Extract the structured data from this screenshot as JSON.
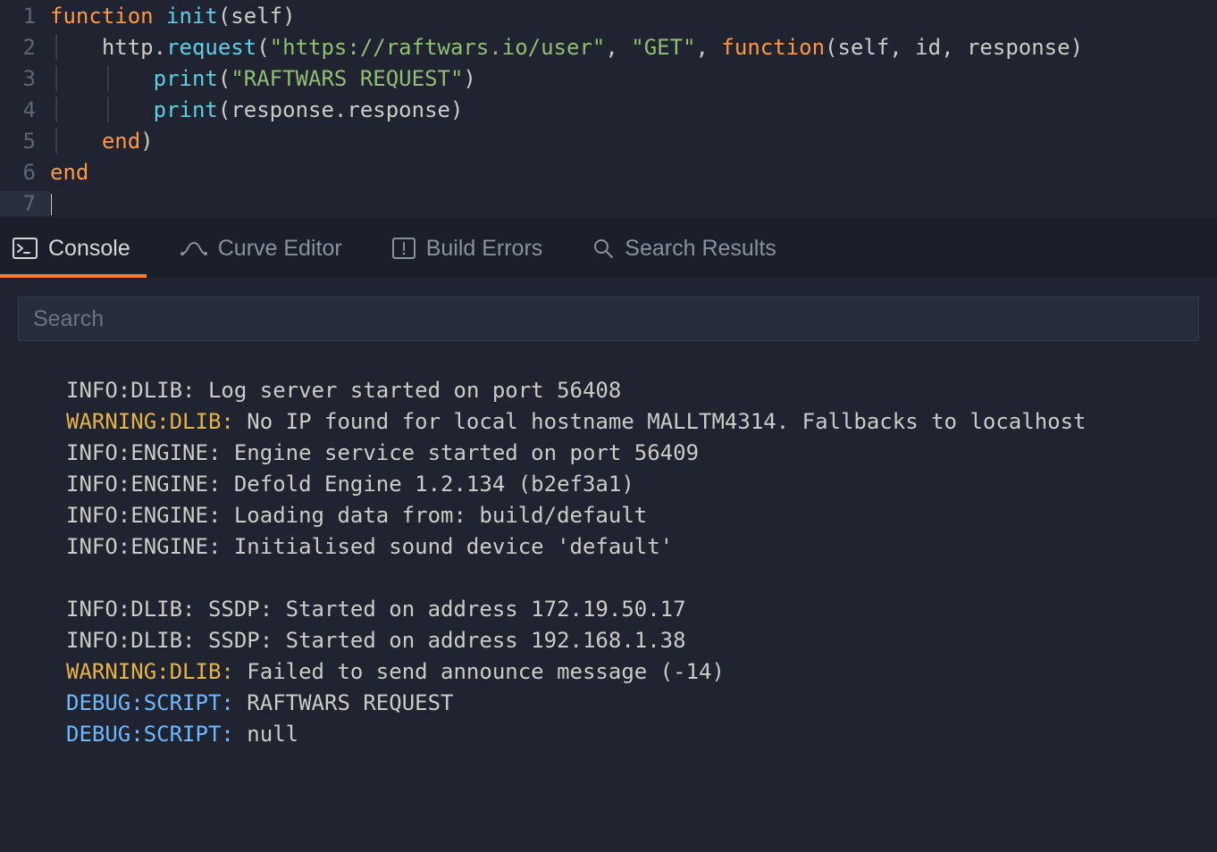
{
  "editor": {
    "lines": [
      {
        "num": "1",
        "html": "<span class='kw'>function</span> <span class='fn'>init</span><span class='pn'>(</span><span class='id'>self</span><span class='pn'>)</span>"
      },
      {
        "num": "2",
        "html": "<span class='guide'>·   </span><span class='id'>http</span><span class='pn'>.</span><span class='fn'>request</span><span class='pn'>(</span><span class='str'>\"https://raftwars.io/user\"</span><span class='pn'>, </span><span class='str'>\"GET\"</span><span class='pn'>, </span><span class='kw'>function</span><span class='pn'>(</span><span class='id'>self</span><span class='pn'>, </span><span class='id'>id</span><span class='pn'>, </span><span class='id'>response</span><span class='pn'>)</span>"
      },
      {
        "num": "3",
        "html": "<span class='guide'>·   ·   </span><span class='fn'>print</span><span class='pn'>(</span><span class='str'>\"RAFTWARS REQUEST\"</span><span class='pn'>)</span>"
      },
      {
        "num": "4",
        "html": "<span class='guide'>·   ·   </span><span class='fn'>print</span><span class='pn'>(</span><span class='id'>response</span><span class='pn'>.</span><span class='id'>response</span><span class='pn'>)</span>"
      },
      {
        "num": "5",
        "html": "<span class='guide'>·   </span><span class='kw'>end</span><span class='pn'>)</span>"
      },
      {
        "num": "6",
        "html": "<span class='kw'>end</span>"
      },
      {
        "num": "7",
        "html": "<span class='cursor'></span>",
        "active": true
      }
    ]
  },
  "tabs": {
    "console": "Console",
    "curve": "Curve Editor",
    "build": "Build Errors",
    "search": "Search Results"
  },
  "console": {
    "search_placeholder": "Search",
    "lines": [
      {
        "prefix": "INFO:DLIB: ",
        "cls": "info",
        "msg": "Log server started on port 56408"
      },
      {
        "prefix": "WARNING:DLIB: ",
        "cls": "warn",
        "msg": "No IP found for local hostname MALLTM4314. Fallbacks to localhost"
      },
      {
        "prefix": "INFO:ENGINE: ",
        "cls": "info",
        "msg": "Engine service started on port 56409"
      },
      {
        "prefix": "INFO:ENGINE: ",
        "cls": "info",
        "msg": "Defold Engine 1.2.134 (b2ef3a1)"
      },
      {
        "prefix": "INFO:ENGINE: ",
        "cls": "info",
        "msg": "Loading data from: build/default"
      },
      {
        "prefix": "INFO:ENGINE: ",
        "cls": "info",
        "msg": "Initialised sound device 'default'"
      },
      {
        "blank": true
      },
      {
        "prefix": "INFO:DLIB: ",
        "cls": "info",
        "msg": "SSDP: Started on address 172.19.50.17"
      },
      {
        "prefix": "INFO:DLIB: ",
        "cls": "info",
        "msg": "SSDP: Started on address 192.168.1.38"
      },
      {
        "prefix": "WARNING:DLIB: ",
        "cls": "warn",
        "msg": "Failed to send announce message (-14)"
      },
      {
        "prefix": "DEBUG:SCRIPT: ",
        "cls": "debug",
        "msg": "RAFTWARS REQUEST"
      },
      {
        "prefix": "DEBUG:SCRIPT: ",
        "cls": "debug",
        "msg": "null"
      }
    ]
  }
}
